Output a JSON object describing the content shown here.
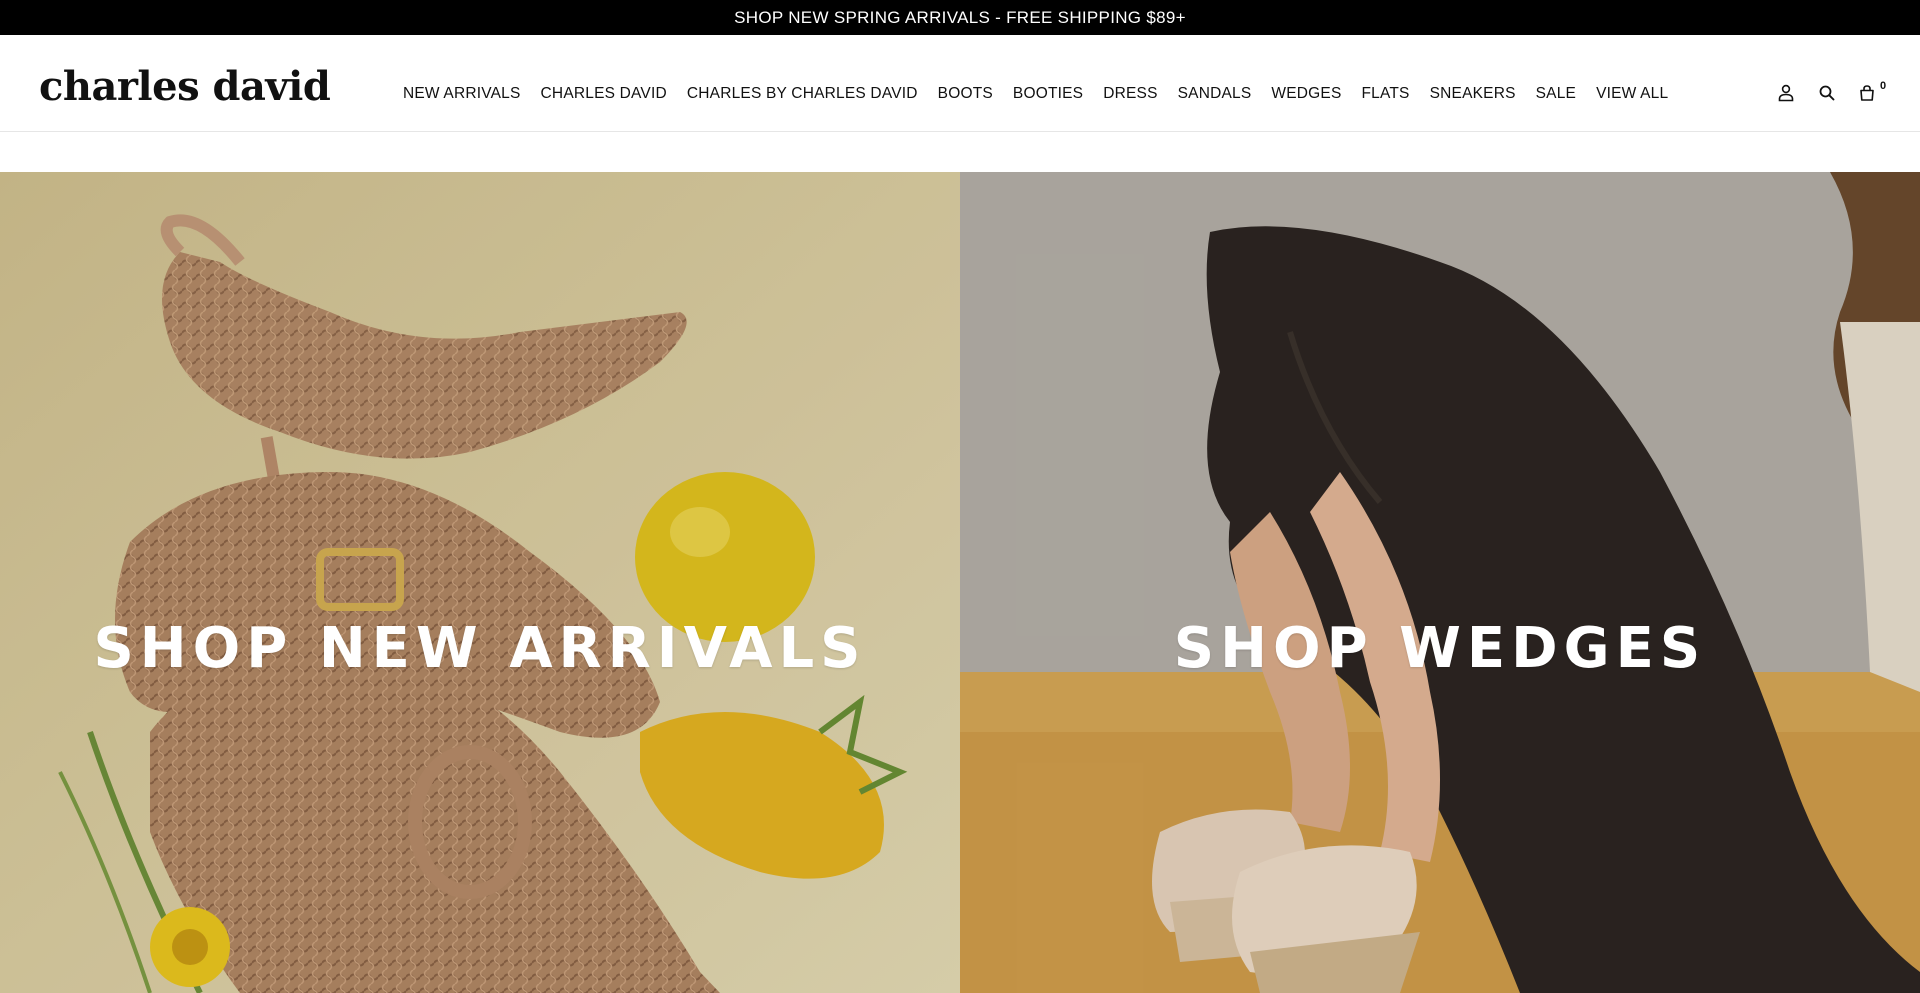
{
  "announcement": {
    "text": "SHOP NEW SPRING ARRIVALS - FREE SHIPPING $89+"
  },
  "brand": {
    "logo_text": "charles david"
  },
  "nav": {
    "items": [
      {
        "label": "NEW ARRIVALS"
      },
      {
        "label": "CHARLES DAVID"
      },
      {
        "label": "CHARLES BY CHARLES DAVID"
      },
      {
        "label": "BOOTS"
      },
      {
        "label": "BOOTIES"
      },
      {
        "label": "DRESS"
      },
      {
        "label": "SANDALS"
      },
      {
        "label": "WEDGES"
      },
      {
        "label": "FLATS"
      },
      {
        "label": "SNEAKERS"
      },
      {
        "label": "SALE"
      },
      {
        "label": "VIEW ALL"
      }
    ]
  },
  "header_icons": {
    "account": "account-icon",
    "search": "search-icon",
    "cart": "cart-icon",
    "cart_count": "0"
  },
  "hero": {
    "left": {
      "title": "SHOP NEW ARRIVALS",
      "image": "woven-slingback-heels-and-loafers-with-lemon-and-dragonfruit"
    },
    "right": {
      "title": "SHOP WEDGES",
      "image": "woman-in-black-dress-wearing-espadrille-wedge-sandals"
    }
  },
  "colors": {
    "announcement_bg": "#000000",
    "announcement_text": "#ffffff",
    "header_bg": "#ffffff",
    "hero_text": "#ffffff"
  }
}
